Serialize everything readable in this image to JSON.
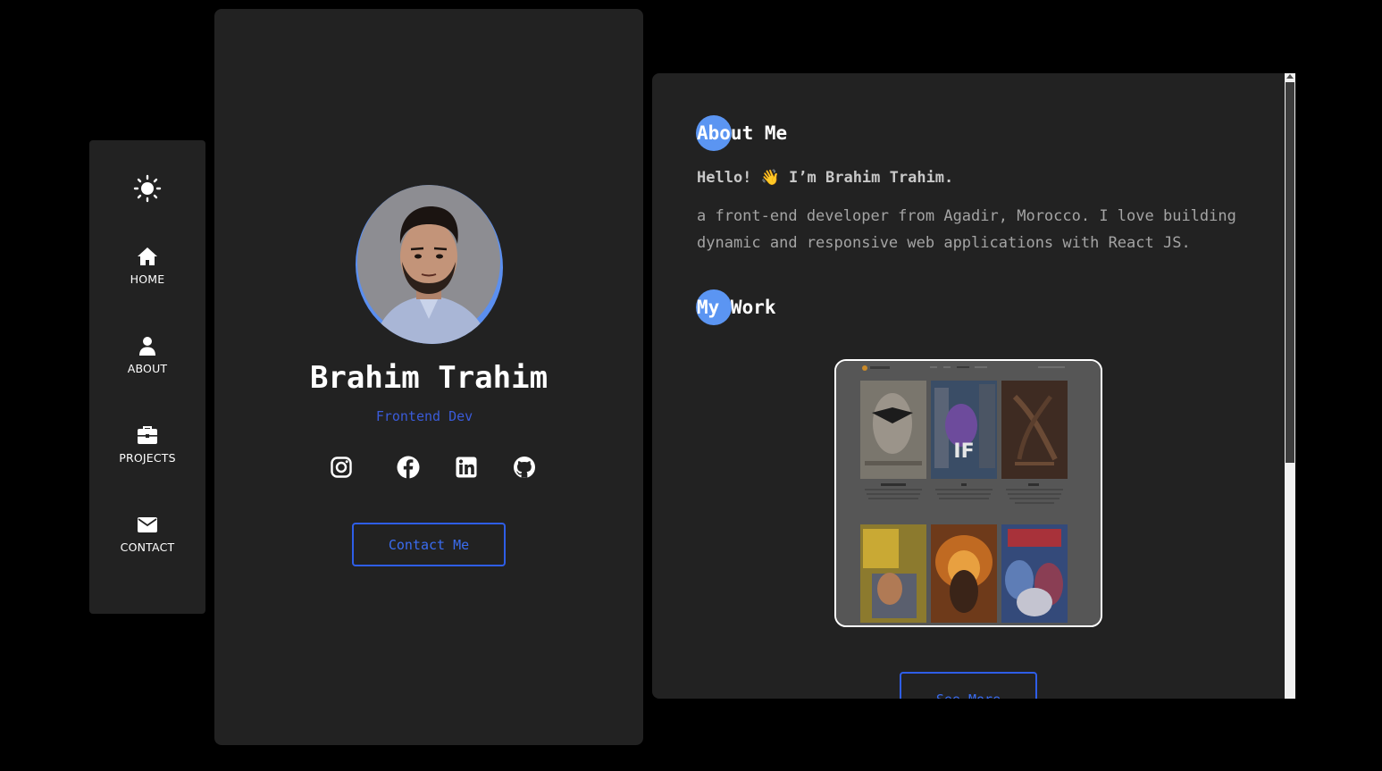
{
  "nav": {
    "theme_icon": "sun-icon",
    "items": [
      {
        "label": "HOME",
        "icon": "home-icon"
      },
      {
        "label": "ABOUT",
        "icon": "user-icon"
      },
      {
        "label": "PROJECTS",
        "icon": "briefcase-icon"
      },
      {
        "label": "CONTACT",
        "icon": "envelope-icon"
      }
    ]
  },
  "profile": {
    "name": "Brahim Trahim",
    "role": "Frontend Dev",
    "socials": [
      "instagram-icon",
      "facebook-icon",
      "linkedin-icon",
      "github-icon"
    ],
    "contact_label": "Contact Me"
  },
  "about": {
    "title": "About Me",
    "hello": "Hello! 👋 I’m Brahim Trahim.",
    "bio": "a front-end developer from Agadir, Morocco. I love building dynamic and responsive web applications with React JS."
  },
  "work": {
    "title": "My Work",
    "see_more_label": "See More"
  },
  "colors": {
    "background": "#000000",
    "panel": "#222222",
    "accent": "#5b95f2",
    "button": "#2e5ee8"
  }
}
